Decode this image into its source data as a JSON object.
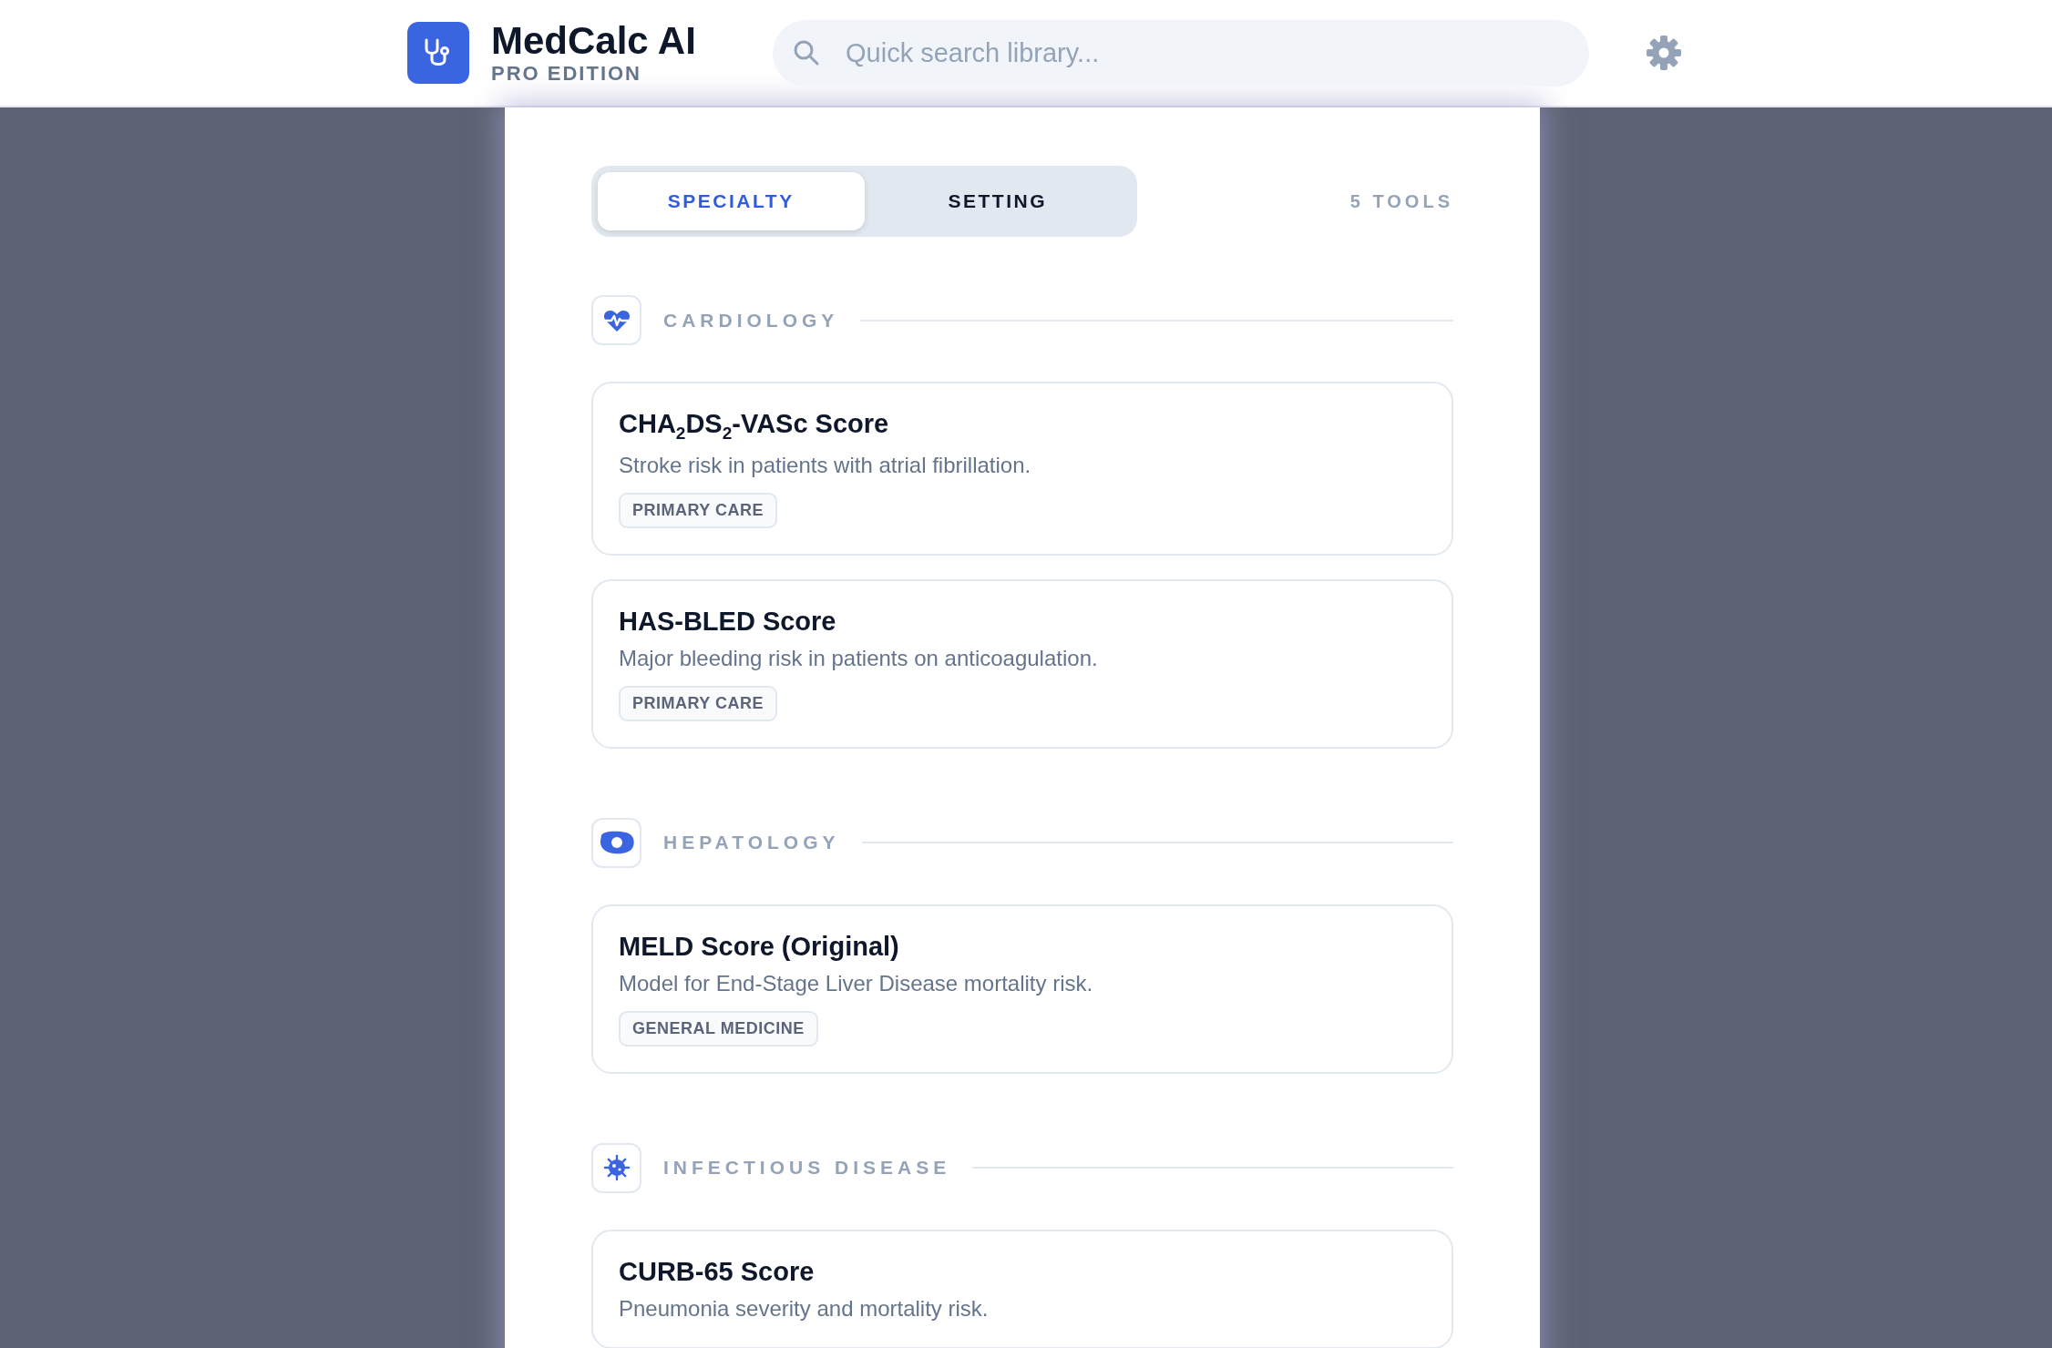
{
  "header": {
    "title": "MedCalc AI",
    "subtitle": "PRO EDITION",
    "search": {
      "placeholder": "Quick search library..."
    }
  },
  "tabs": [
    {
      "label": "SPECIALTY",
      "selected": true
    },
    {
      "label": "SETTING",
      "selected": false
    }
  ],
  "tool_count": "5 TOOLS",
  "sections": [
    {
      "title": "CARDIOLOGY",
      "items": [
        {
          "name": "CHA$_{2}$DS$_{2}$-VASc Score",
          "description": "Stroke risk in patients with atrial fibrillation.",
          "tag": "PRIMARY CARE"
        },
        {
          "name": "HAS-BLED Score",
          "description": "Major bleeding risk in patients on anticoagulation.",
          "tag": "PRIMARY CARE"
        }
      ]
    },
    {
      "title": "HEPATOLOGY",
      "items": [
        {
          "name": "MELD Score (Original)",
          "description": "Model for End-Stage Liver Disease mortality risk.",
          "tag": "GENERAL MEDICINE"
        }
      ]
    },
    {
      "title": "INFECTIOUS DISEASE",
      "items": [
        {
          "name": "CURB-65 Score",
          "description": "Pneumonia severity and mortality risk."
        }
      ]
    }
  ]
}
